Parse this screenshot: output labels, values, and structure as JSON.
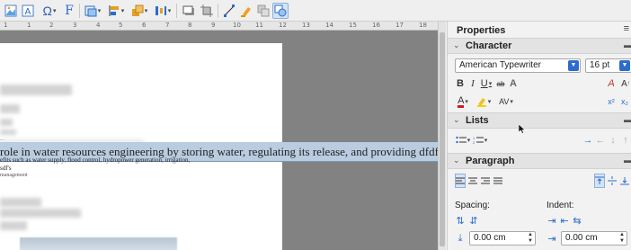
{
  "toolbar": {
    "icons": [
      "image-icon",
      "text-frame-icon",
      "special-character-icon",
      "fontwork-icon",
      "wrap-icon",
      "align-objects-icon",
      "arrange-icon",
      "distribute-icon",
      "shadow-icon",
      "crop-icon",
      "points-icon",
      "highlight-icon",
      "group-icon",
      "select-icon"
    ]
  },
  "ruler": {
    "marks": [
      "1",
      "1",
      "2",
      "3",
      "4",
      "5",
      "6",
      "7",
      "8",
      "9",
      "10",
      "11",
      "12",
      "13",
      "14",
      "15",
      "16",
      "17",
      "18"
    ]
  },
  "document": {
    "small_line_1": "...",
    "selected_line": "role in water resources engineering by storing water, regulating its release, and providing dfdfsdf",
    "small_line_2": "efits such as water supply, flood control, hydropower generation, irrigation,",
    "small_line_3": "sdf's",
    "small_line_4": "management"
  },
  "sidebar": {
    "title": "Properties",
    "menu_glyph": "≡",
    "character": {
      "header": "Character",
      "font_name": "American Typewriter",
      "font_size": "16 pt"
    },
    "lists": {
      "header": "Lists"
    },
    "paragraph": {
      "header": "Paragraph",
      "spacing_label": "Spacing:",
      "indent_label": "Indent:",
      "spacing_value": "0.00 cm",
      "indent_value": "0.00 cm"
    }
  },
  "colors": {
    "accent": "#2b6ccf",
    "selection": "#b9cce0",
    "doc_background": "#828282"
  }
}
